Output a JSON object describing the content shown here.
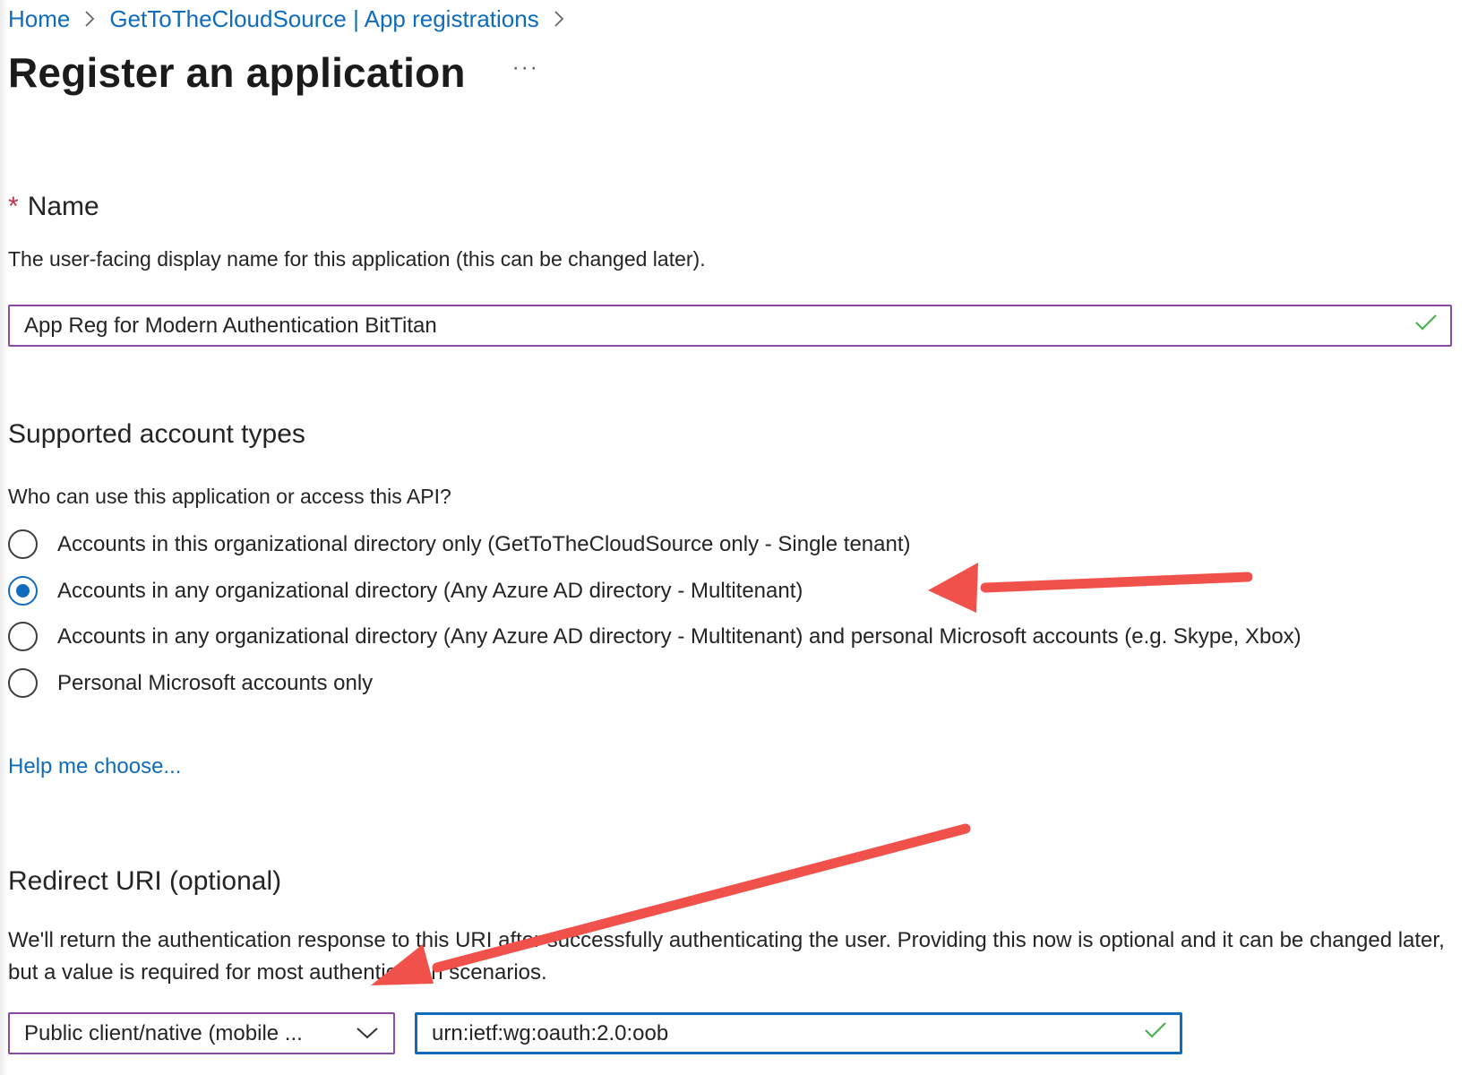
{
  "breadcrumb": {
    "items": [
      "Home",
      "GetToTheCloudSource | App registrations"
    ]
  },
  "page": {
    "title": "Register an application",
    "more": "···"
  },
  "name_section": {
    "required_marker": "*",
    "label": "Name",
    "description": "The user-facing display name for this application (this can be changed later).",
    "value": "App Reg for Modern Authentication BitTitan"
  },
  "account_types": {
    "title": "Supported account types",
    "question": "Who can use this application or access this API?",
    "options": [
      {
        "label": "Accounts in this organizational directory only (GetToTheCloudSource only - Single tenant)",
        "selected": false
      },
      {
        "label": "Accounts in any organizational directory (Any Azure AD directory - Multitenant)",
        "selected": true
      },
      {
        "label": "Accounts in any organizational directory (Any Azure AD directory - Multitenant) and personal Microsoft accounts (e.g. Skype, Xbox)",
        "selected": false
      },
      {
        "label": "Personal Microsoft accounts only",
        "selected": false
      }
    ],
    "help_link": "Help me choose..."
  },
  "redirect": {
    "title": "Redirect URI (optional)",
    "description": "We'll return the authentication response to this URI after successfully authenticating the user. Providing this now is optional and it can be changed later, but a value is required for most authentication scenarios.",
    "platform_value": "Public client/native (mobile ...",
    "uri_value": "urn:ietf:wg:oauth:2.0:oob"
  },
  "colors": {
    "link": "#0f6cbd",
    "input_border": "#8a4aa8",
    "focus_border": "#0f6cbd",
    "valid_check": "#4caf50",
    "required": "#c4314b",
    "annotation_arrow": "#f0524b"
  },
  "icons": [
    "chevron-right-icon",
    "checkmark-icon",
    "chevron-down-icon",
    "annotation-arrow"
  ]
}
